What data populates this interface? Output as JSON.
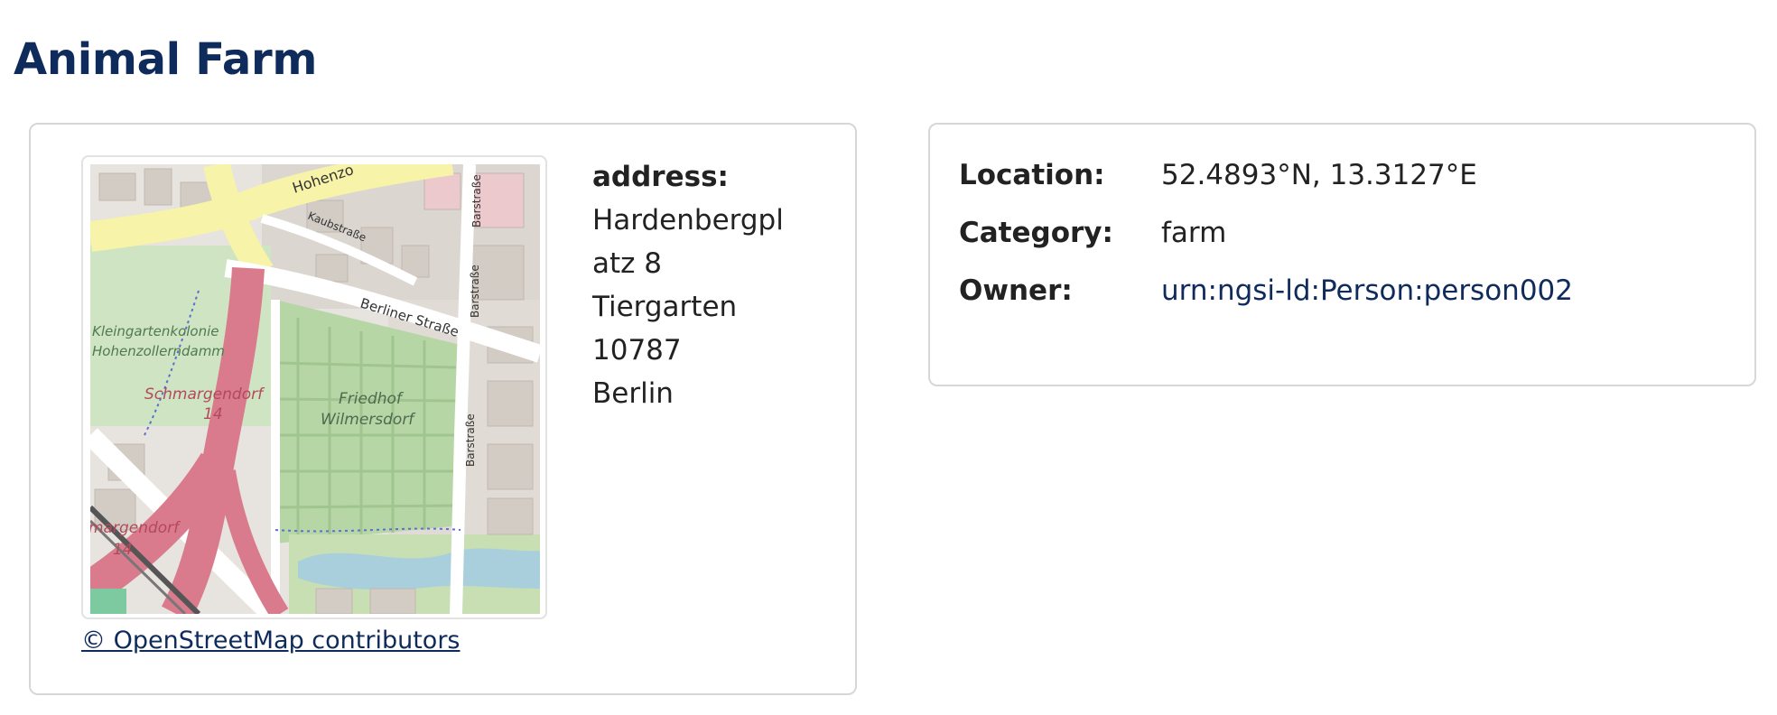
{
  "page": {
    "title": "Animal Farm"
  },
  "address_card": {
    "map": {
      "attribution": "© OpenStreetMap contributors",
      "labels": {
        "hohenzollern": "Hohenzo",
        "kaubstrasse": "Kaubstraße",
        "berliner_strasse": "Berliner Straße",
        "barstrasse_top": "Barstraße",
        "barstrasse_mid": "Barstraße",
        "barstrasse_low": "Barstraße",
        "kolonie_1": "Kleingartenkolonie",
        "kolonie_2": "Hohenzollerndamm",
        "schmargendorf_1": "Schmargendorf",
        "schmargendorf_1_num": "14",
        "friedhof_1": "Friedhof",
        "friedhof_2": "Wilmersdorf",
        "schmargendorf_2": "margendorf",
        "schmargendorf_2_num": "14"
      }
    },
    "address_label": "address:",
    "address_lines": [
      "Hardenbergpl",
      "atz 8",
      "Tiergarten",
      "10787",
      "Berlin"
    ]
  },
  "details_card": {
    "location": {
      "label": "Location:",
      "value": "52.4893°N, 13.3127°E"
    },
    "category": {
      "label": "Category:",
      "value": "farm"
    },
    "owner": {
      "label": "Owner:",
      "value": "urn:ngsi-ld:Person:person002"
    }
  },
  "colors": {
    "title": "#0e2b5c",
    "link": "#0e2b5c",
    "border": "#d7d7d7",
    "map_road_main": "#f7f3a8",
    "map_road_red": "#d97b8c",
    "map_green": "#c7dfb3",
    "map_water": "#a9cfdd"
  }
}
